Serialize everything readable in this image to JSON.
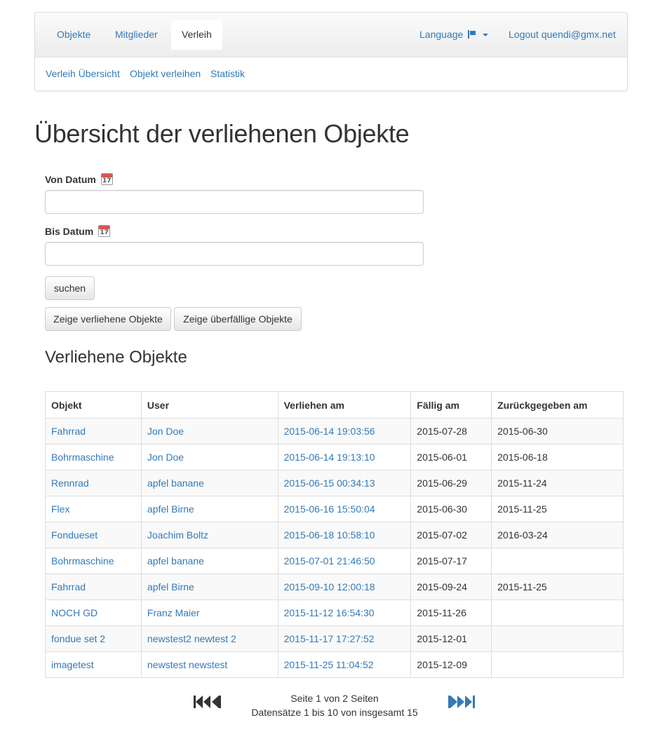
{
  "nav": {
    "tabs": [
      {
        "label": "Objekte"
      },
      {
        "label": "Mitglieder"
      },
      {
        "label": "Verleih"
      }
    ],
    "language_label": "Language",
    "logout_label": "Logout quendi@gmx.net",
    "subnav": [
      {
        "label": "Verleih Übersicht"
      },
      {
        "label": "Objekt verleihen"
      },
      {
        "label": "Statistik"
      }
    ]
  },
  "page_title": "Übersicht der verliehenen Objekte",
  "form": {
    "from_label": "Von Datum",
    "from_value": "",
    "to_label": "Bis Datum",
    "to_value": "",
    "calendar_icon_day": "17",
    "search_button": "suchen",
    "show_lent_button": "Zeige verliehene Objekte",
    "show_overdue_button": "Zeige überfällige Objekte"
  },
  "section_title": "Verliehene Objekte",
  "table": {
    "headers": [
      "Objekt",
      "User",
      "Verliehen am",
      "Fällig am",
      "Zurückgegeben am"
    ],
    "rows": [
      [
        "Fahrrad",
        "Jon Doe",
        "2015-06-14 19:03:56",
        "2015-07-28",
        "2015-06-30"
      ],
      [
        "Bohrmaschine",
        "Jon Doe",
        "2015-06-14 19:13:10",
        "2015-06-01",
        "2015-06-18"
      ],
      [
        "Rennrad",
        "apfel banane",
        "2015-06-15 00:34:13",
        "2015-06-29",
        "2015-11-24"
      ],
      [
        "Flex",
        "apfel Birne",
        "2015-06-16 15:50:04",
        "2015-06-30",
        "2015-11-25"
      ],
      [
        "Fondueset",
        "Joachim Boltz",
        "2015-06-18 10:58:10",
        "2015-07-02",
        "2016-03-24"
      ],
      [
        "Bohrmaschine",
        "apfel banane",
        "2015-07-01 21:46:50",
        "2015-07-17",
        ""
      ],
      [
        "Fahrrad",
        "apfel Birne",
        "2015-09-10 12:00:18",
        "2015-09-24",
        "2015-11-25"
      ],
      [
        "NOCH GD",
        "Franz Maier",
        "2015-11-12 16:54:30",
        "2015-11-26",
        ""
      ],
      [
        "fondue set 2",
        "newstest2 newtest 2",
        "2015-11-17 17:27:52",
        "2015-12-01",
        ""
      ],
      [
        "imagetest",
        "newstest newstest",
        "2015-11-25 11:04:52",
        "2015-12-09",
        ""
      ]
    ]
  },
  "pager": {
    "page_info": "Seite 1 von 2 Seiten",
    "record_info": "Datensätze 1 bis 10 von insgesamt 15",
    "first_prev_icon_color": "#333333",
    "next_last_icon_color": "#337ab7"
  },
  "colors": {
    "link": "#337ab7",
    "text": "#333333",
    "table_stripe": "#f9f9f9"
  }
}
